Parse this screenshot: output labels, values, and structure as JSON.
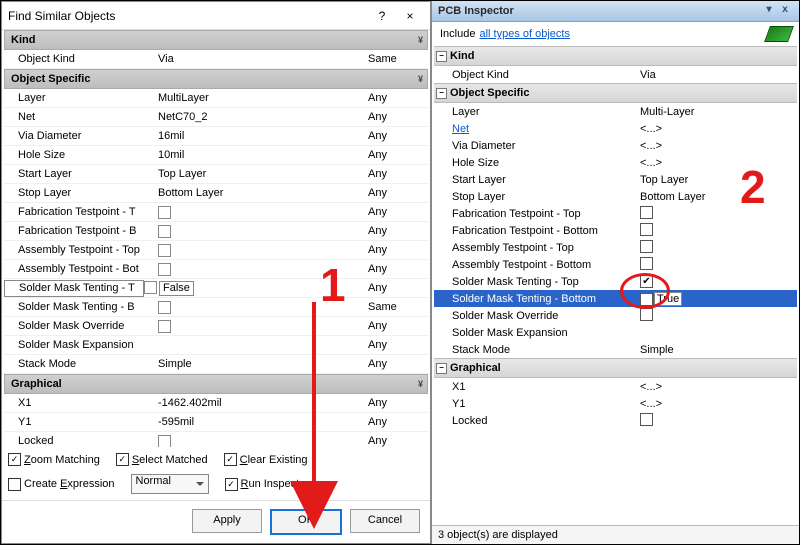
{
  "dialog": {
    "title": "Find Similar Objects",
    "help_icon": "?",
    "close_icon": "×",
    "sections": {
      "kind_label": "Kind",
      "kind_rows": [
        {
          "name": "Object Kind",
          "value": "Via",
          "match": "Same"
        }
      ],
      "objspec_label": "Object Specific",
      "objspec_rows": [
        {
          "name": "Layer",
          "value": "MultiLayer",
          "match": "Any",
          "type": "text"
        },
        {
          "name": "Net",
          "value": "NetC70_2",
          "match": "Any",
          "type": "text"
        },
        {
          "name": "Via Diameter",
          "value": "16mil",
          "match": "Any",
          "type": "text"
        },
        {
          "name": "Hole Size",
          "value": "10mil",
          "match": "Any",
          "type": "text"
        },
        {
          "name": "Start Layer",
          "value": "Top Layer",
          "match": "Any",
          "type": "text"
        },
        {
          "name": "Stop Layer",
          "value": "Bottom Layer",
          "match": "Any",
          "type": "text"
        },
        {
          "name": "Fabrication Testpoint - T",
          "value": "",
          "match": "Any",
          "type": "check"
        },
        {
          "name": "Fabrication Testpoint - B",
          "value": "",
          "match": "Any",
          "type": "check"
        },
        {
          "name": "Assembly Testpoint - Top",
          "value": "",
          "match": "Any",
          "type": "check"
        },
        {
          "name": "Assembly Testpoint - Bot",
          "value": "",
          "match": "Any",
          "type": "check"
        },
        {
          "name": "Solder Mask Tenting - T",
          "value": "False",
          "match": "Any",
          "type": "checkval",
          "selected": true
        },
        {
          "name": "Solder Mask Tenting - B",
          "value": "",
          "match": "Same",
          "type": "check"
        },
        {
          "name": "Solder Mask Override",
          "value": "",
          "match": "Any",
          "type": "check"
        },
        {
          "name": "Solder Mask Expansion",
          "value": "",
          "match": "Any",
          "type": "text"
        },
        {
          "name": "Stack Mode",
          "value": "Simple",
          "match": "Any",
          "type": "text"
        }
      ],
      "graph_label": "Graphical",
      "graph_rows": [
        {
          "name": "X1",
          "value": "-1462.402mil",
          "match": "Any",
          "type": "text"
        },
        {
          "name": "Y1",
          "value": "-595mil",
          "match": "Any",
          "type": "text"
        },
        {
          "name": "Locked",
          "value": "",
          "match": "Any",
          "type": "check"
        }
      ]
    },
    "options": {
      "zoom_matching": "Zoom Matching",
      "select_matched": "Select Matched",
      "clear_existing": "Clear Existing",
      "create_expression": "Create Expression",
      "mask_mode": "Normal",
      "run_inspector": "Run Inspector"
    },
    "buttons": {
      "apply": "Apply",
      "ok": "OK",
      "cancel": "Cancel"
    }
  },
  "inspector": {
    "title": "PCB Inspector",
    "include_pre": "Include",
    "include_link": "all types of objects",
    "kind_label": "Kind",
    "kind_rows": [
      {
        "name": "Object Kind",
        "value": "Via"
      }
    ],
    "objspec_label": "Object Specific",
    "objspec_rows": [
      {
        "name": "Layer",
        "value": "Multi-Layer",
        "type": "text"
      },
      {
        "name": "Net",
        "value": "<...>",
        "type": "link"
      },
      {
        "name": "Via Diameter",
        "value": "<...>",
        "type": "text"
      },
      {
        "name": "Hole Size",
        "value": "<...>",
        "type": "text"
      },
      {
        "name": "Start Layer",
        "value": "Top Layer",
        "type": "text"
      },
      {
        "name": "Stop Layer",
        "value": "Bottom Layer",
        "type": "text"
      },
      {
        "name": "Fabrication Testpoint - Top",
        "value": "",
        "type": "check",
        "checked": false
      },
      {
        "name": "Fabrication Testpoint - Bottom",
        "value": "",
        "type": "check",
        "checked": false
      },
      {
        "name": "Assembly Testpoint - Top",
        "value": "",
        "type": "check",
        "checked": false
      },
      {
        "name": "Assembly Testpoint - Bottom",
        "value": "",
        "type": "check",
        "checked": false
      },
      {
        "name": "Solder Mask Tenting - Top",
        "value": "",
        "type": "check",
        "checked": true
      },
      {
        "name": "Solder Mask Tenting - Bottom",
        "value": "True",
        "type": "checkval",
        "checked": true,
        "selected": true
      },
      {
        "name": "Solder Mask Override",
        "value": "",
        "type": "check",
        "checked": false
      },
      {
        "name": "Solder Mask Expansion",
        "value": "",
        "type": "text"
      },
      {
        "name": "Stack Mode",
        "value": "Simple",
        "type": "text"
      }
    ],
    "graph_label": "Graphical",
    "graph_rows": [
      {
        "name": "X1",
        "value": "<...>",
        "type": "text"
      },
      {
        "name": "Y1",
        "value": "<...>",
        "type": "text"
      },
      {
        "name": "Locked",
        "value": "",
        "type": "check",
        "checked": false
      }
    ],
    "status": "3 object(s) are displayed"
  },
  "annotations": {
    "one": "1",
    "two": "2"
  }
}
